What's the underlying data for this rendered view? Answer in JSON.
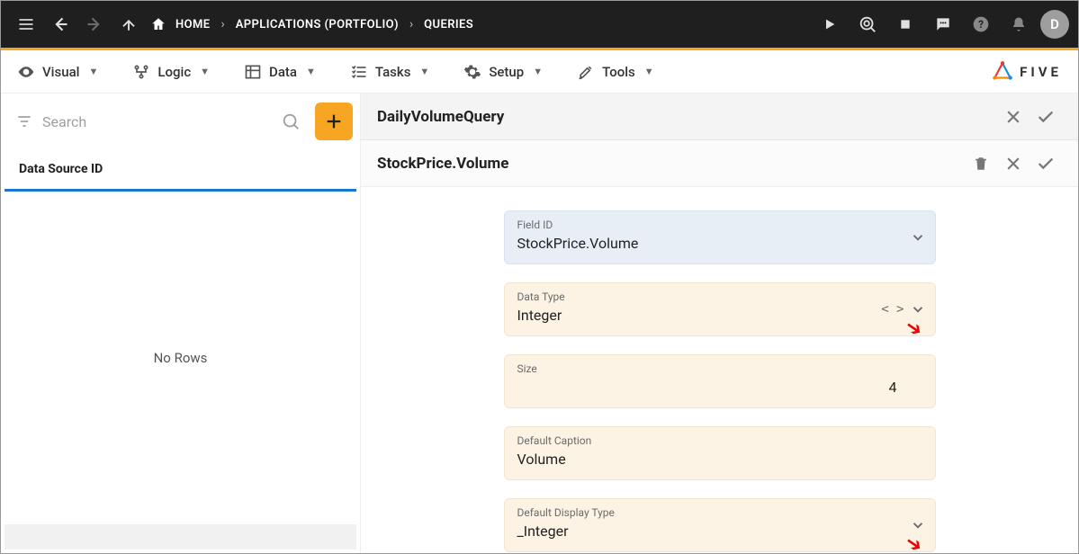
{
  "topbar": {
    "breadcrumbs": [
      "HOME",
      "APPLICATIONS (PORTFOLIO)",
      "QUERIES"
    ],
    "avatar_letter": "D"
  },
  "menubar": {
    "items": [
      {
        "label": "Visual"
      },
      {
        "label": "Logic"
      },
      {
        "label": "Data"
      },
      {
        "label": "Tasks"
      },
      {
        "label": "Setup"
      },
      {
        "label": "Tools"
      }
    ],
    "logo_text": "FIVE"
  },
  "leftpane": {
    "search_placeholder": "Search",
    "list_header": "Data Source ID",
    "no_rows": "No Rows"
  },
  "rightpane": {
    "header1_title": "DailyVolumeQuery",
    "header2_title": "StockPrice.Volume",
    "fields": {
      "field_id": {
        "label": "Field ID",
        "value": "StockPrice.Volume"
      },
      "data_type": {
        "label": "Data Type",
        "value": "Integer"
      },
      "size": {
        "label": "Size",
        "value": "4"
      },
      "default_caption": {
        "label": "Default Caption",
        "value": "Volume"
      },
      "default_display_type": {
        "label": "Default Display Type",
        "value": "_Integer"
      }
    }
  }
}
